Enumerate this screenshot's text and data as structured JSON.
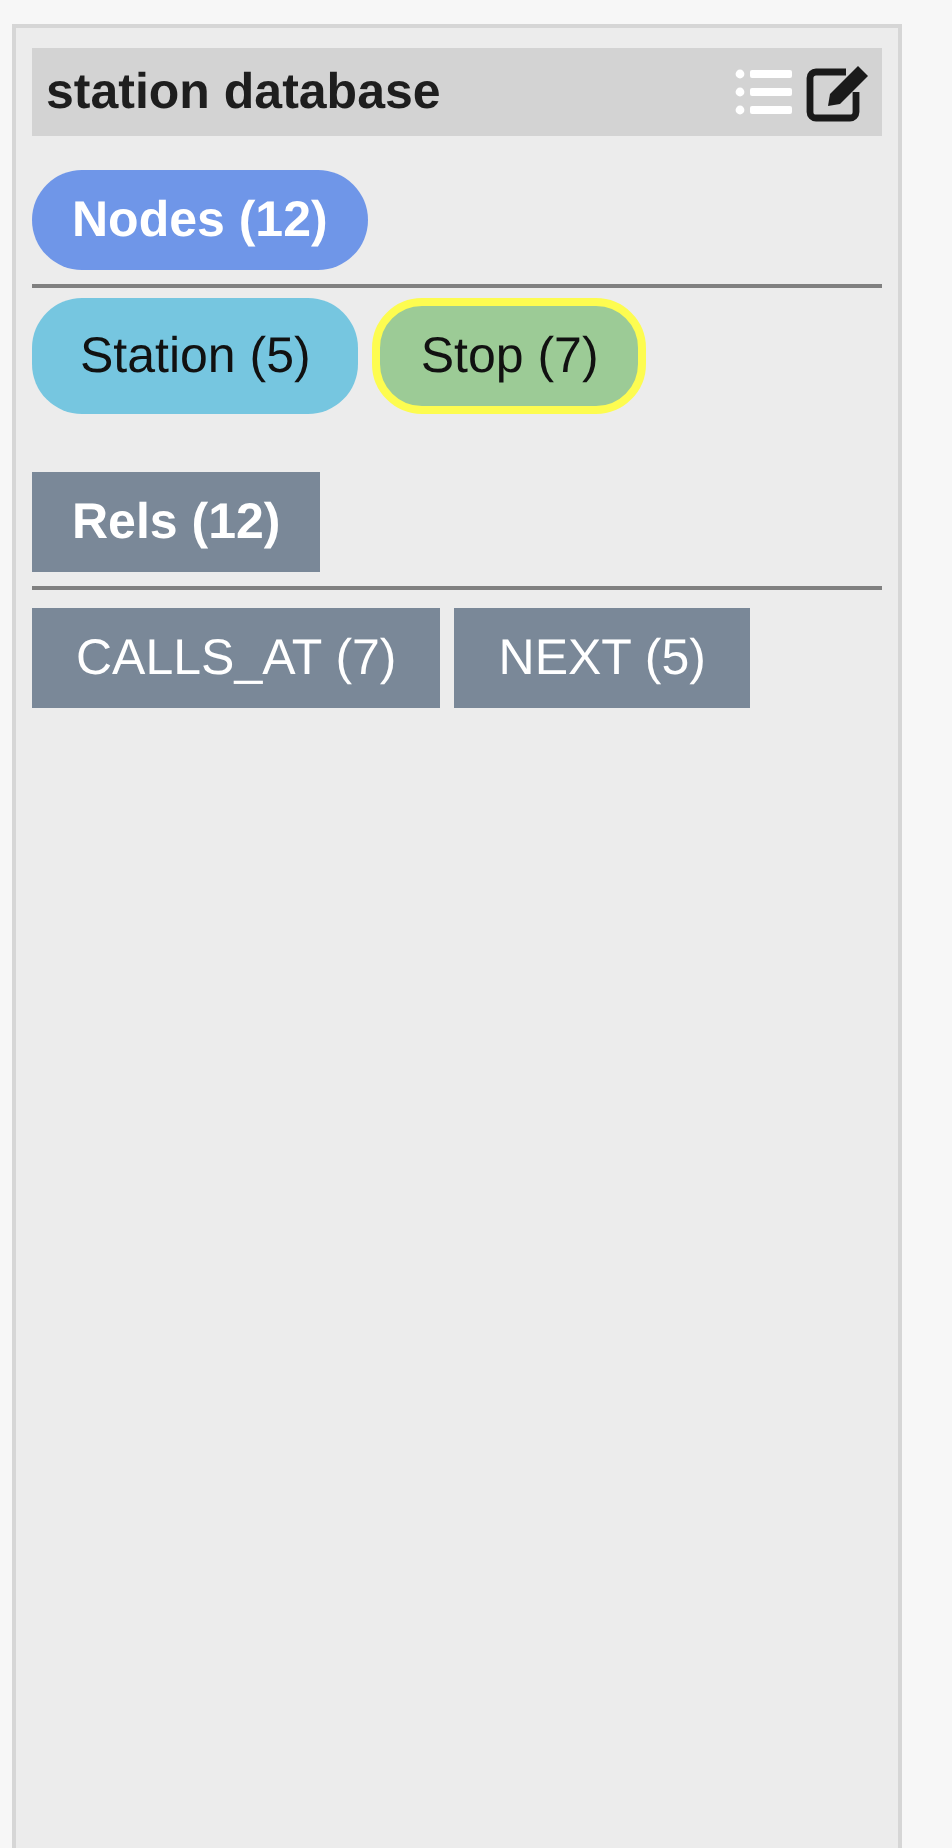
{
  "header": {
    "title": "station database"
  },
  "nodes": {
    "label": "Nodes (12)",
    "labels": [
      {
        "text": "Station (5)",
        "color": "#76c6e0",
        "selected": false
      },
      {
        "text": "Stop (7)",
        "color": "#9ccb96",
        "selected": true
      }
    ]
  },
  "relationships": {
    "label": "Rels (12)",
    "types": [
      {
        "text": "CALLS_AT (7)",
        "selected": false
      },
      {
        "text": "NEXT (5)",
        "selected": false
      }
    ]
  }
}
